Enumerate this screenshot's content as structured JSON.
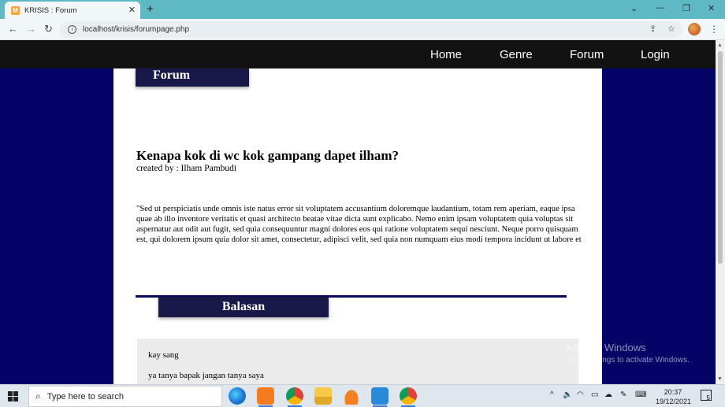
{
  "browser": {
    "tab_title": "KRISIS : Forum",
    "favicon_letter": "M",
    "url": "localhost/krisis/forumpage.php"
  },
  "nav": {
    "items": [
      "Home",
      "Genre",
      "Forum",
      "Login"
    ]
  },
  "forum": {
    "badge": "Forum",
    "title": "Kenapa kok di wc kok gampang dapet ilham?",
    "author": "created by : Ilham Pambudi",
    "body": "\"Sed ut perspiciatis unde omnis iste natus error sit voluptatem accusantium doloremque laudantium, totam rem aperiam, eaque ipsa quae ab illo inventore veritatis et quasi architecto beatae vitae dicta sunt explicabo. Nemo enim ipsam voluptatem quia voluptas sit aspernatur aut odit aut fugit, sed quia consequuntur magni dolores eos qui ratione voluptatem sequi nesciunt. Neque porro quisquam est, qui dolorem ipsum quia dolor sit amet, consectetur, adipisci velit, sed quia non numquam eius modi tempora incidunt ut labore et"
  },
  "replies": {
    "badge": "Balasan",
    "items": [
      "kay sang",
      "ya tanya bapak jangan tanya saya"
    ]
  },
  "watermark": {
    "line1": "Activate Windows",
    "line2": "Go to Settings to activate Windows."
  },
  "taskbar": {
    "search_placeholder": "Type here to search",
    "time": "20:37",
    "date": "19/12/2021",
    "notification_count": "5"
  },
  "colors": {
    "page_background": "#040466",
    "nav_background": "#121212",
    "badge_background": "#191949",
    "tabbar": "#5fb9c4"
  }
}
